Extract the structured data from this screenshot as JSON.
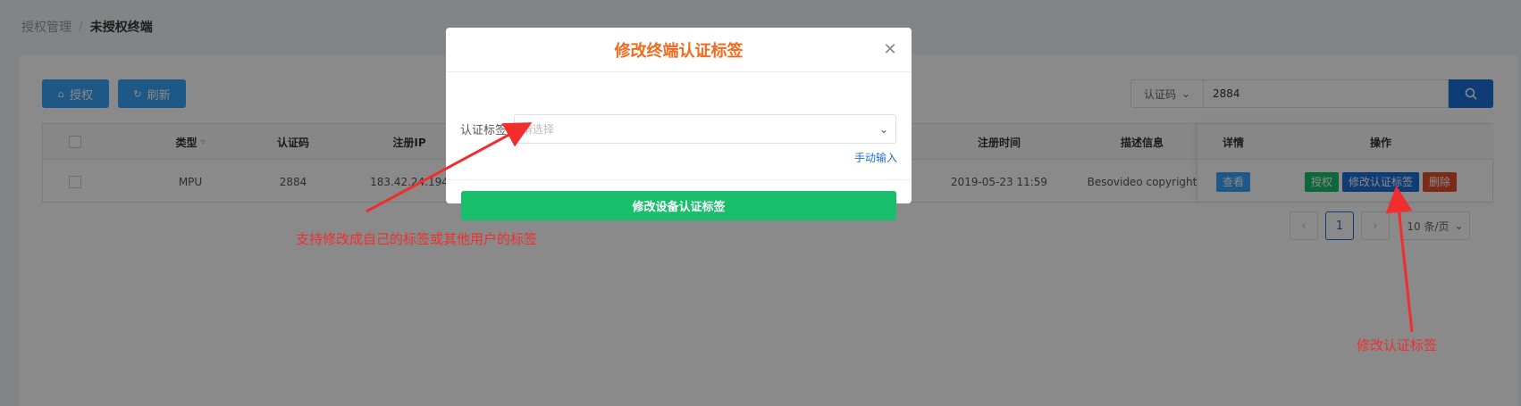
{
  "breadcrumb": {
    "parent": "授权管理",
    "separator": "/",
    "current": "未授权终端"
  },
  "toolbar": {
    "authorize_label": "授权",
    "refresh_label": "刷新"
  },
  "search": {
    "field_label": "认证码",
    "value": "2884"
  },
  "table": {
    "headers": {
      "type": "类型",
      "auth_code": "认证码",
      "register_ip": "注册IP",
      "register_time": "注册时间",
      "description": "描述信息",
      "details": "详情",
      "actions": "操作"
    },
    "rows": [
      {
        "type": "MPU",
        "auth_code": "2884",
        "register_ip": "183.42.24.194",
        "register_time": "2019-05-23 11:59",
        "description": "Besovideo copyright",
        "view_label": "查看",
        "authorize_label": "授权",
        "modify_label": "修改认证标签",
        "delete_label": "删除"
      }
    ]
  },
  "pagination": {
    "prev": "‹",
    "current_page": "1",
    "next": "›",
    "page_size": "10 条/页"
  },
  "modal": {
    "title": "修改终端认证标签",
    "field_label": "认证标签",
    "select_placeholder": "请选择",
    "manual_input_link": "手动输入",
    "submit_label": "修改设备认证标签"
  },
  "annotations": {
    "left_note": "支持修改成自己的标签或其他用户的标签",
    "right_note": "修改认证标签"
  },
  "colors": {
    "primary": "#36a3f7",
    "search_blue": "#1e6fd9",
    "success": "#19be6b",
    "danger": "#e0502e",
    "title_orange": "#f26b1d",
    "annotation_red": "#f02e2e"
  },
  "icons": {
    "authorize": "home-icon",
    "refresh": "refresh-icon",
    "search": "search-icon",
    "filter": "filter-icon",
    "close": "close-icon",
    "dropdown": "chevron-down-icon"
  }
}
